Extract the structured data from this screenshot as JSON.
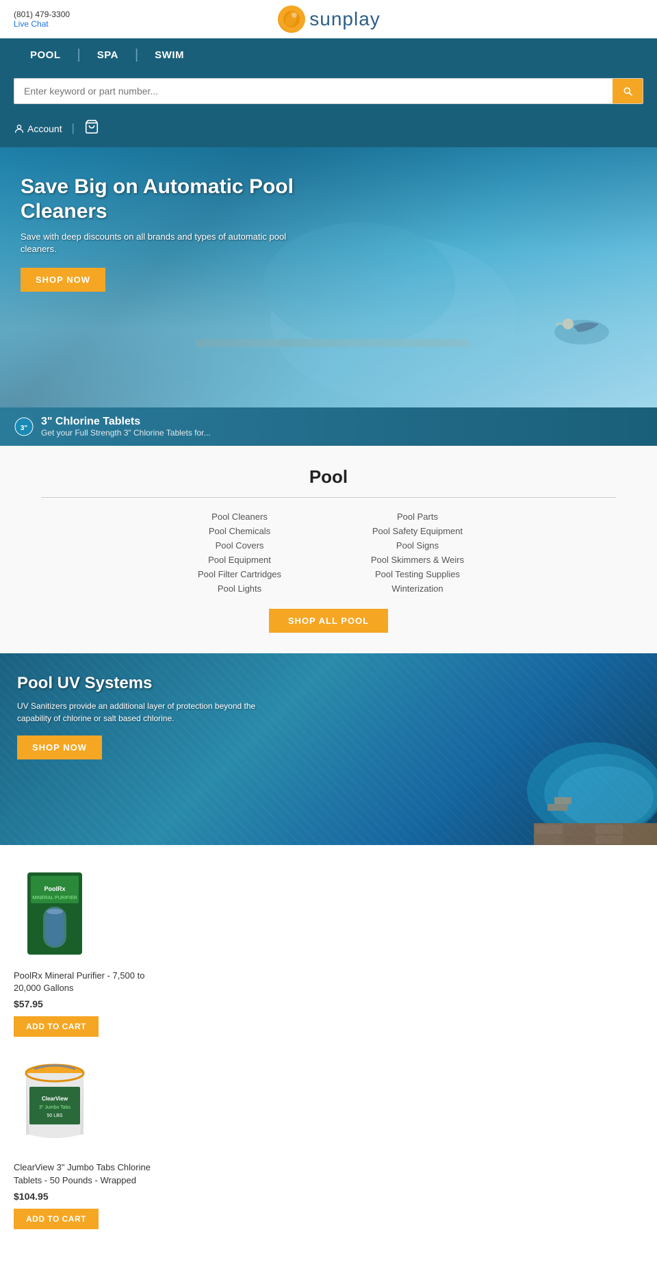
{
  "topbar": {
    "phone": "(801) 479-3300",
    "live_chat": "Live Chat"
  },
  "logo": {
    "text": "sunplay"
  },
  "nav": {
    "items": [
      {
        "label": "POOL",
        "id": "pool"
      },
      {
        "label": "SPA",
        "id": "spa"
      },
      {
        "label": "SWIM",
        "id": "swim"
      }
    ]
  },
  "search": {
    "placeholder": "Enter keyword or part number..."
  },
  "account": {
    "label": "Account"
  },
  "hero": {
    "title": "Save Big on Automatic Pool Cleaners",
    "subtitle": "Save with deep discounts on all brands and types of automatic pool cleaners.",
    "shop_now": "SHOP NOW"
  },
  "chlorine": {
    "title": "3\" Chlorine Tablets",
    "subtitle": "Get your Full Strength 3\" Chlorine Tablets for..."
  },
  "pool_section": {
    "title": "Pool",
    "links_left": [
      "Pool Cleaners",
      "Pool Chemicals",
      "Pool Covers",
      "Pool Equipment",
      "Pool Filter Cartridges",
      "Pool Lights"
    ],
    "links_right": [
      "Pool Parts",
      "Pool Safety Equipment",
      "Pool Signs",
      "Pool Skimmers & Weirs",
      "Pool Testing Supplies",
      "Winterization"
    ],
    "shop_all_label": "SHOP ALL POOL"
  },
  "uv_banner": {
    "title": "Pool UV Systems",
    "subtitle": "UV Sanitizers provide an additional layer of protection beyond the capability of chlorine or salt based chlorine.",
    "shop_now": "SHOP NOW"
  },
  "products": [
    {
      "id": "poolrx",
      "name": "PoolRx Mineral Purifier - 7,500 to 20,000 Gallons",
      "price": "$57.95",
      "add_to_cart": "ADD TO CART",
      "type": "poolrx"
    },
    {
      "id": "clearview",
      "name": "ClearView 3\" Jumbo Tabs Chlorine Tablets - 50 Pounds - Wrapped",
      "price": "$104.95",
      "add_to_cart": "ADD TO CART",
      "type": "clearview"
    }
  ],
  "colors": {
    "nav_bg": "#1a5f7a",
    "orange": "#f5a623",
    "link": "#555"
  }
}
